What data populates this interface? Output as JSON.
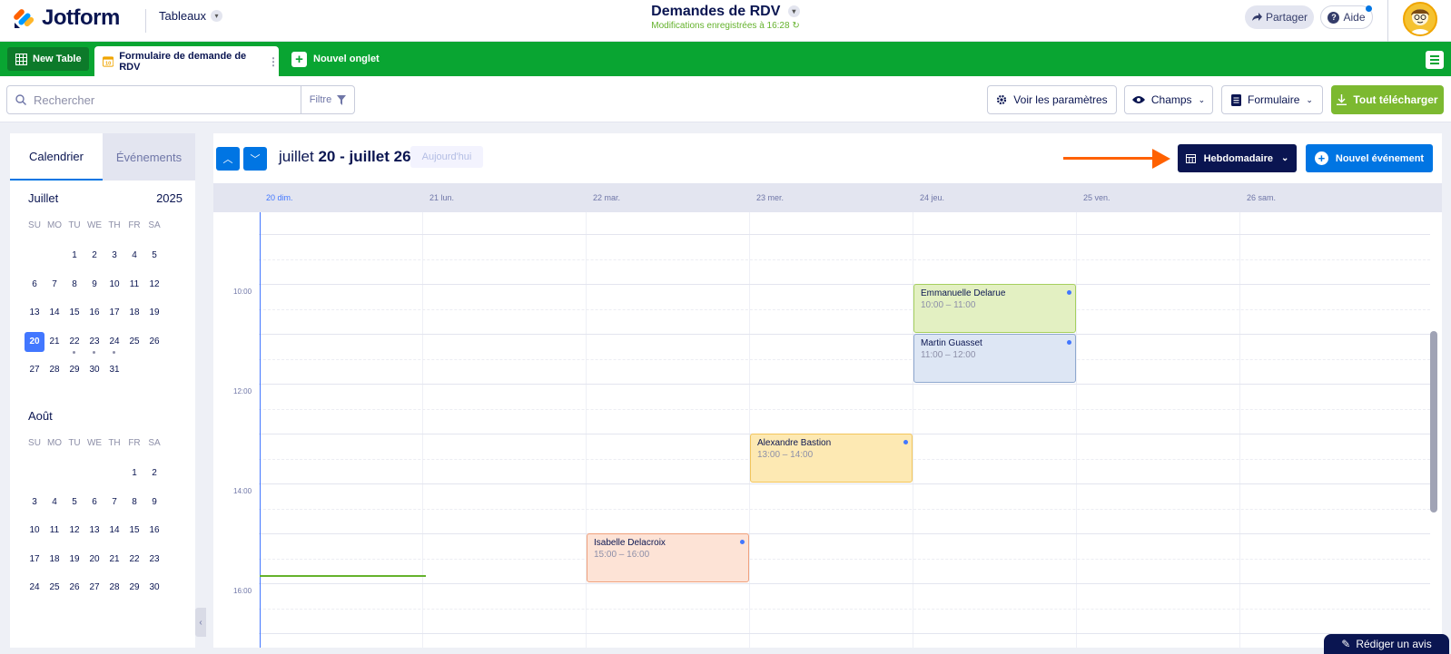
{
  "app": {
    "brand": "Jotform",
    "workspace": "Tableaux",
    "doc_title": "Demandes de RDV",
    "save_status": "Modifications enregistrées à 16:28",
    "share_label": "Partager",
    "help_label": "Aide"
  },
  "tabs": {
    "new_table": "New Table",
    "form_tab": "Formulaire de demande de RDV",
    "add_tab": "Nouvel onglet"
  },
  "toolbar": {
    "search_placeholder": "Rechercher",
    "filter_label": "Filtre",
    "settings_label": "Voir les paramètres",
    "fields_label": "Champs",
    "form_label": "Formulaire",
    "download_label": "Tout télécharger"
  },
  "sidebar": {
    "tab_calendar": "Calendrier",
    "tab_events": "Événements",
    "weekdays": [
      "SU",
      "MO",
      "TU",
      "WE",
      "TH",
      "FR",
      "SA"
    ],
    "months": [
      {
        "name": "Juillet",
        "year": "2025",
        "weeks": [
          [
            "",
            "",
            "1",
            "2",
            "3",
            "4",
            "5"
          ],
          [
            "6",
            "7",
            "8",
            "9",
            "10",
            "11",
            "12"
          ],
          [
            "13",
            "14",
            "15",
            "16",
            "17",
            "18",
            "19"
          ],
          [
            "20",
            "21",
            "22",
            "23",
            "24",
            "25",
            "26"
          ],
          [
            "27",
            "28",
            "29",
            "30",
            "31",
            "",
            ""
          ]
        ],
        "selected": "20",
        "event_days": [
          "22",
          "23",
          "24"
        ]
      },
      {
        "name": "Août",
        "year": "",
        "weeks": [
          [
            "",
            "",
            "",
            "",
            "",
            "1",
            "2"
          ],
          [
            "3",
            "4",
            "5",
            "6",
            "7",
            "8",
            "9"
          ],
          [
            "10",
            "11",
            "12",
            "13",
            "14",
            "15",
            "16"
          ],
          [
            "17",
            "18",
            "19",
            "20",
            "21",
            "22",
            "23"
          ],
          [
            "24",
            "25",
            "26",
            "27",
            "28",
            "29",
            "30"
          ]
        ],
        "selected": "",
        "event_days": []
      }
    ]
  },
  "calendar": {
    "range_prefix": "juillet ",
    "range_start": "20",
    "range_sep": " - juillet ",
    "range_end": "26",
    "today_label": "Aujourd'hui",
    "view_label": "Hebdomadaire",
    "new_event_label": "Nouvel événement",
    "days": [
      "20 dim.",
      "21 lun.",
      "22 mar.",
      "23 mer.",
      "24 jeu.",
      "25 ven.",
      "26 sam."
    ],
    "time_labels": [
      "10:00",
      "12:00",
      "14:00",
      "16:00"
    ],
    "events": [
      {
        "name": "Emmanuelle Delarue",
        "time": "10:00 – 11:00",
        "day": 4,
        "start": 10,
        "end": 11,
        "bg": "#e3f0c2",
        "border": "#a5cf5e"
      },
      {
        "name": "Martin Guasset",
        "time": "11:00 – 12:00",
        "day": 4,
        "start": 11,
        "end": 12,
        "bg": "#dde6f4",
        "border": "#8fa8cf"
      },
      {
        "name": "Alexandre Bastion",
        "time": "13:00 – 14:00",
        "day": 3,
        "start": 13,
        "end": 14,
        "bg": "#fde9b3",
        "border": "#f2c55c"
      },
      {
        "name": "Isabelle Delacroix",
        "time": "15:00 – 16:00",
        "day": 2,
        "start": 15,
        "end": 16,
        "bg": "#fde3d6",
        "border": "#f0a07c"
      }
    ]
  },
  "footer": {
    "review_label": "Rédiger un avis"
  },
  "colors": {
    "accent_blue": "#0075e3",
    "tab_green": "#09a532",
    "download_green": "#7cb930",
    "navy": "#0a1551",
    "arrow_orange": "#ff6100"
  }
}
